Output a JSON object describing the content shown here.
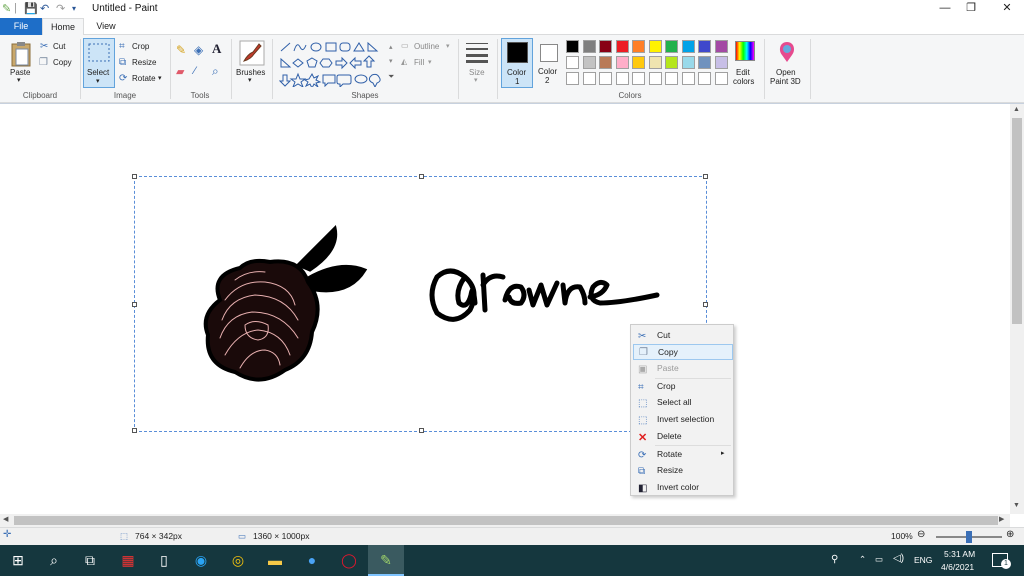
{
  "window": {
    "title": "Untitled - Paint",
    "controls": {
      "minimize": "—",
      "restore": "❐",
      "close": "✕"
    }
  },
  "menu_tabs": {
    "file": "File",
    "home": "Home",
    "view": "View"
  },
  "ribbon": {
    "clipboard": {
      "paste": "Paste",
      "cut": "Cut",
      "copy": "Copy",
      "group": "Clipboard"
    },
    "image": {
      "select": "Select",
      "crop": "Crop",
      "resize": "Resize",
      "rotate": "Rotate",
      "group": "Image"
    },
    "tools": {
      "group": "Tools"
    },
    "brushes": {
      "label": "Brushes"
    },
    "shapes": {
      "outline": "Outline",
      "fill": "Fill",
      "group": "Shapes"
    },
    "size": {
      "label": "Size"
    },
    "color1": {
      "label": "Color",
      "num": "1",
      "value": "#000000"
    },
    "color2": {
      "label": "Color",
      "num": "2",
      "value": "#ffffff"
    },
    "colors": {
      "group": "Colors",
      "row1": [
        "#000000",
        "#7f7f7f",
        "#880015",
        "#ed1c24",
        "#ff7f27",
        "#fff200",
        "#22b14c",
        "#00a2e8",
        "#3f48cc",
        "#a349a4"
      ],
      "row2": [
        "#ffffff",
        "#c3c3c3",
        "#b97a57",
        "#ffaec9",
        "#ffc90e",
        "#efe4b0",
        "#b5e61d",
        "#99d9ea",
        "#7092be",
        "#c8bfe7"
      ],
      "row3": [
        "#ffffff",
        "#ffffff",
        "#ffffff",
        "#ffffff",
        "#ffffff",
        "#ffffff",
        "#ffffff",
        "#ffffff",
        "#ffffff",
        "#ffffff"
      ]
    },
    "edit_colors": {
      "line1": "Edit",
      "line2": "colors"
    },
    "paint3d": {
      "line1": "Open",
      "line2": "Paint 3D"
    }
  },
  "context_menu": {
    "items": [
      {
        "label": "Cut",
        "enabled": true
      },
      {
        "label": "Copy",
        "enabled": true,
        "highlighted": true
      },
      {
        "label": "Paste",
        "enabled": false
      },
      {
        "label": "Crop",
        "enabled": true
      },
      {
        "label": "Select all",
        "enabled": true
      },
      {
        "label": "Invert selection",
        "enabled": true
      },
      {
        "label": "Delete",
        "enabled": true
      },
      {
        "label": "Rotate",
        "enabled": true,
        "submenu": true
      },
      {
        "label": "Resize",
        "enabled": true
      },
      {
        "label": "Invert color",
        "enabled": true
      }
    ]
  },
  "status": {
    "selection_size": "764 × 342px",
    "image_size": "1360 × 1000px",
    "zoom": "100%",
    "zoom_level_percent": 100
  },
  "taskbar": {
    "language": "ENG",
    "time": "5:31 AM",
    "date": "4/6/2021",
    "notification_count": "1"
  }
}
